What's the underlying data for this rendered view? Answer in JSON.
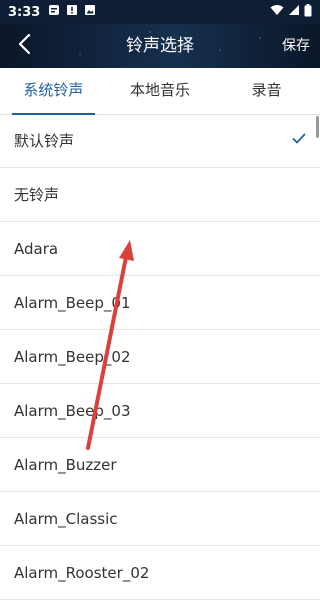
{
  "status_bar": {
    "time": "3:33",
    "icons": [
      "notification-icon",
      "alert-icon",
      "image-icon",
      "wifi-icon",
      "signal-icon",
      "battery-icon"
    ]
  },
  "header": {
    "back_icon": "chevron-left-icon",
    "title": "铃声选择",
    "save_label": "保存"
  },
  "tabs": [
    {
      "label": "系统铃声",
      "active": true
    },
    {
      "label": "本地音乐",
      "active": false
    },
    {
      "label": "录音",
      "active": false
    }
  ],
  "ringtones": [
    {
      "label": "默认铃声",
      "selected": true
    },
    {
      "label": "无铃声",
      "selected": false
    },
    {
      "label": "Adara",
      "selected": false
    },
    {
      "label": "Alarm_Beep_01",
      "selected": false
    },
    {
      "label": "Alarm_Beep_02",
      "selected": false
    },
    {
      "label": "Alarm_Beep_03",
      "selected": false
    },
    {
      "label": "Alarm_Buzzer",
      "selected": false
    },
    {
      "label": "Alarm_Classic",
      "selected": false
    },
    {
      "label": "Alarm_Rooster_02",
      "selected": false
    }
  ],
  "colors": {
    "accent": "#1f5fa8",
    "header_bg": "#0b1a2e",
    "annotation_arrow": "#d9423a"
  },
  "annotation": {
    "type": "arrow",
    "direction": "up"
  }
}
